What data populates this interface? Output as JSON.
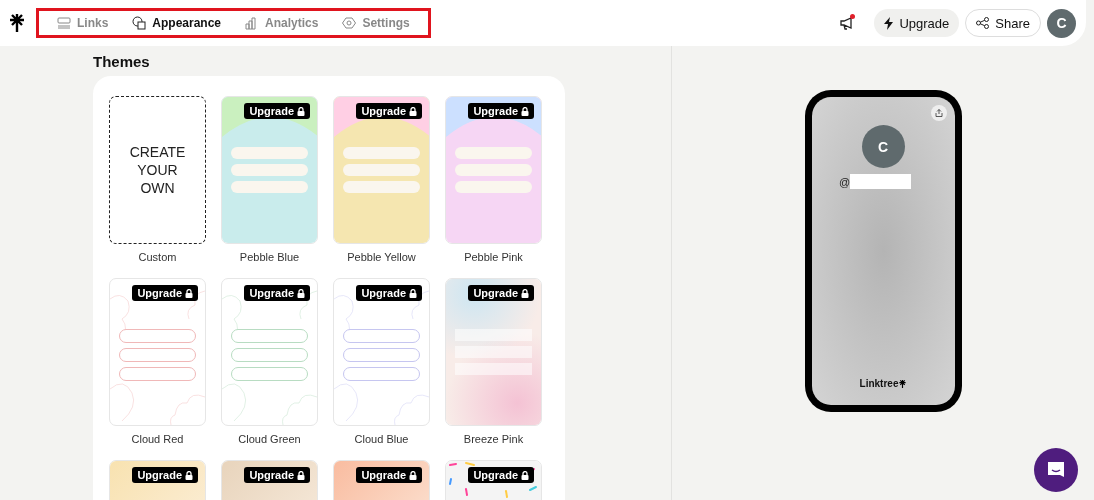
{
  "nav": {
    "tabs": [
      {
        "label": "Links",
        "kind": "links",
        "selected": false
      },
      {
        "label": "Appearance",
        "kind": "appearance",
        "selected": true
      },
      {
        "label": "Analytics",
        "kind": "analytics",
        "selected": false
      },
      {
        "label": "Settings",
        "kind": "settings",
        "selected": false
      }
    ],
    "notification": true,
    "upgrade_button": "Upgrade",
    "share_button": "Share",
    "avatar": "C"
  },
  "themes": {
    "title": "Themes",
    "items": [
      {
        "kind": "custom",
        "preview_text": "CREATE YOUR OWN",
        "name": "Custom"
      },
      {
        "kind": "pebble",
        "color": "#c9ecec",
        "badge": "Upgrade",
        "name": "Pebble Blue"
      },
      {
        "kind": "pebble",
        "color": "#f5e6b0",
        "badge": "Upgrade",
        "name": "Pebble Yellow"
      },
      {
        "kind": "pebble",
        "color": "#f6d6f4",
        "badge": "Upgrade",
        "name": "Pebble Pink"
      },
      {
        "kind": "cloud",
        "color": "#f0b8b8",
        "badge": "Upgrade",
        "name": "Cloud Red"
      },
      {
        "kind": "cloud",
        "color": "#b8dcc2",
        "badge": "Upgrade",
        "name": "Cloud Green"
      },
      {
        "kind": "cloud",
        "color": "#c6c6f0",
        "badge": "Upgrade",
        "name": "Cloud Blue"
      },
      {
        "kind": "breeze",
        "color": "#f4c2d4",
        "badge": "Upgrade",
        "name": "Breeze Pink"
      },
      {
        "kind": "gradient",
        "color": "#f8e2b0",
        "badge": "Upgrade"
      },
      {
        "kind": "gradient",
        "color": "#e8d4bc",
        "badge": "Upgrade"
      },
      {
        "kind": "gradient",
        "color": "#f9bca0",
        "badge": "Upgrade"
      },
      {
        "kind": "sprinkles",
        "color": "#f4f4f4",
        "badge": "Upgrade"
      }
    ]
  },
  "preview": {
    "avatar": "C",
    "handle_prefix": "@",
    "footer": "Linktree"
  }
}
